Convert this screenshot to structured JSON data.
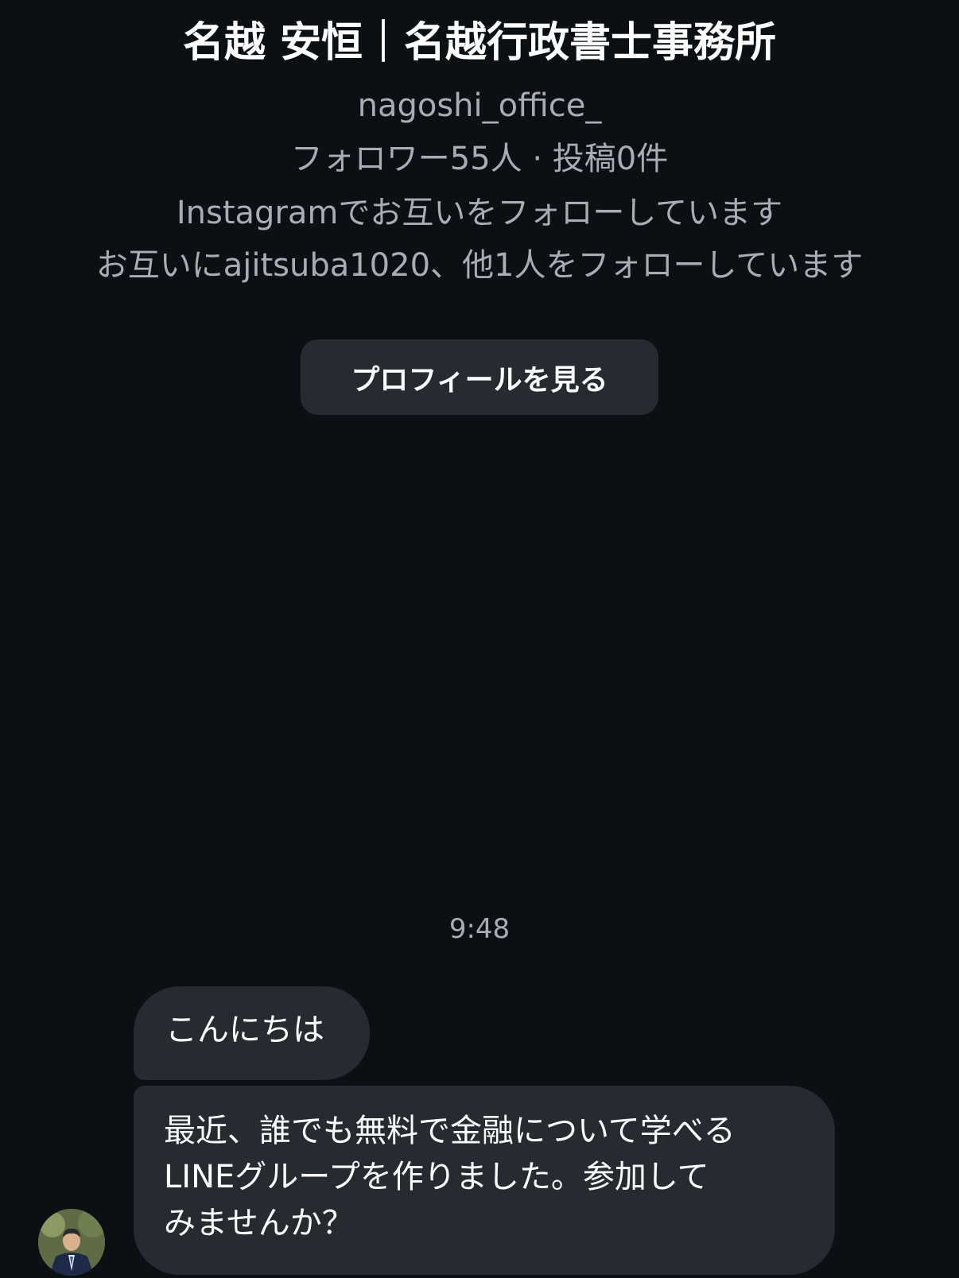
{
  "header": {
    "profile_name": "名越 安恒｜名越行政書士事務所",
    "username": "nagoshi_office_",
    "stats": "フォロワー55人 · 投稿0件",
    "mutual": "Instagramでお互いをフォローしています",
    "mutual_follow": "お互いにajitsuba1020、他1人をフォローしています"
  },
  "view_profile_label": "プロフィールを見る",
  "conversation": {
    "timestamp": "9:48",
    "messages": [
      {
        "text": "こんにちは"
      },
      {
        "lines": [
          "最近、誰でも無料で金融について学べる",
          "LINEグループを作りました。参加して",
          "みませんか？"
        ]
      }
    ]
  },
  "colors": {
    "background": "#0b1014",
    "bubble": "#262b31",
    "secondary_text": "#a8adb3"
  }
}
